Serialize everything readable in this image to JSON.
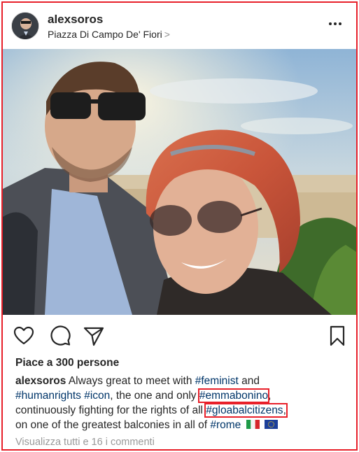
{
  "post": {
    "username": "alexsoros",
    "location": "Piazza Di Campo De' Fiori",
    "location_chevron": ">",
    "likes_text": "Piace a 300 persone",
    "caption": {
      "author": "alexsoros",
      "t1": " Always great to meet with ",
      "tag_feminist": "#feminist",
      "t2": " and",
      "tag_humanrights": "#humanrights",
      "t3": " ",
      "tag_icon": "#icon",
      "t4": ", the one and only ",
      "tag_emmabonino": "#emmabonino",
      "t5": ",",
      "t6": "continuously fighting for the rights of all ",
      "tag_gloabal": "#gloabalcitizens",
      "t7": ",",
      "t8": "on one of the greatest balconies in all of ",
      "tag_rome": "#rome"
    },
    "view_comments": "Visualizza tutti e 16 i commenti"
  },
  "icons": {
    "more": "more-options-icon",
    "like": "heart-icon",
    "comment": "comment-icon",
    "share": "paper-plane-icon",
    "save": "bookmark-icon",
    "flag_it": "italy-flag-icon",
    "flag_eu": "eu-flag-icon"
  },
  "colors": {
    "hashtag": "#003569",
    "highlight_box": "#e8202a",
    "muted": "#999999"
  }
}
